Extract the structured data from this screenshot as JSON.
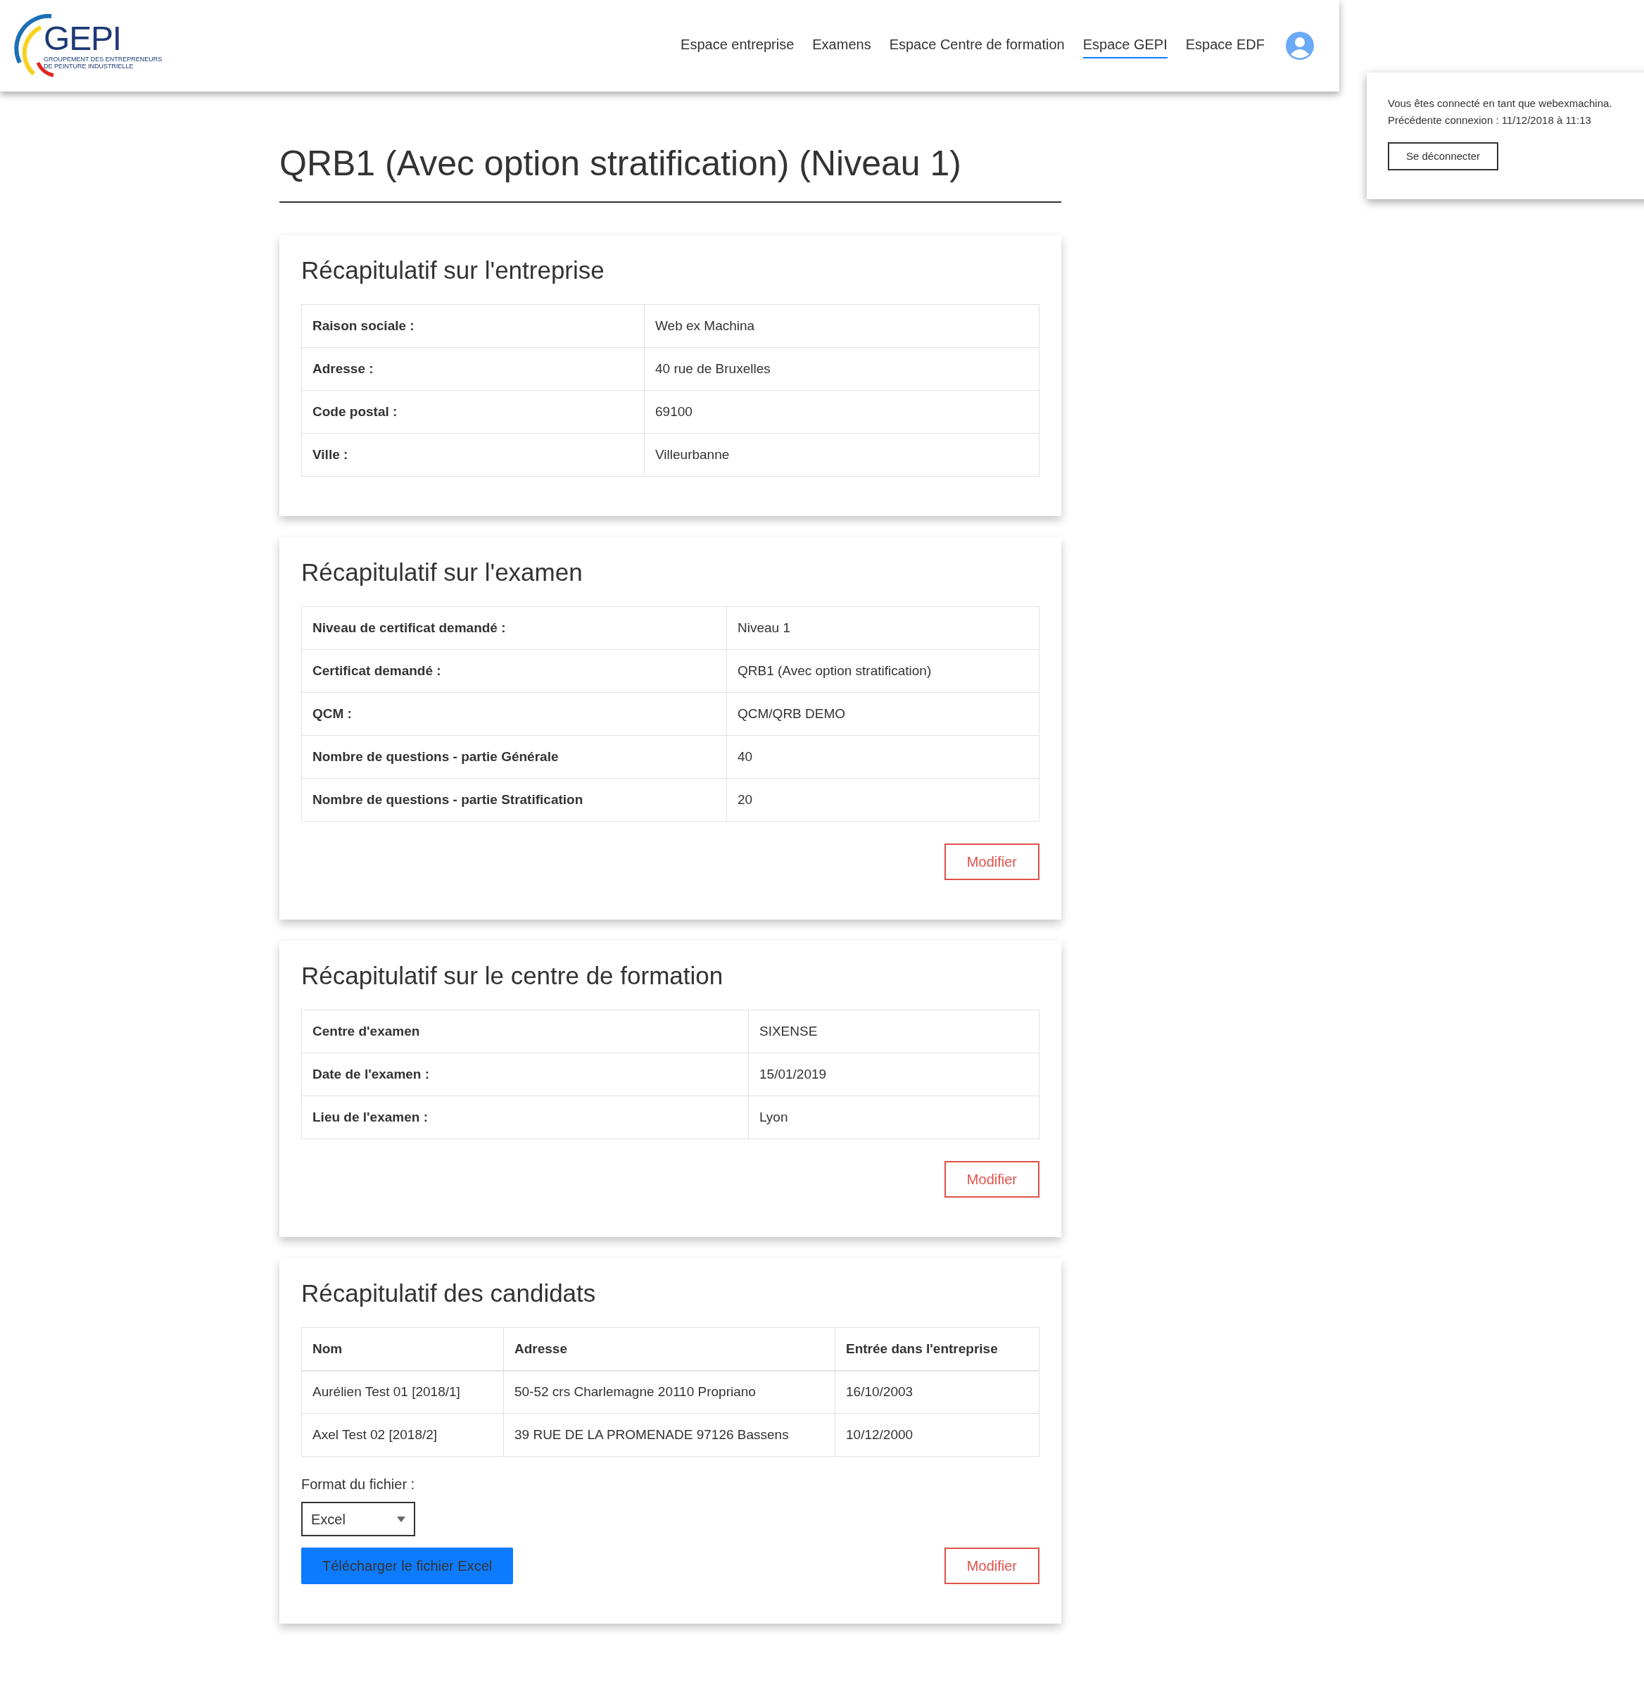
{
  "header": {
    "logo": {
      "name": "GEPI",
      "tagline_1": "GROUPEMENT DES ENTREPRENEURS",
      "tagline_2": "DE PEINTURE INDUSTRIELLE"
    },
    "nav": [
      {
        "label": "Espace entreprise",
        "selected": false
      },
      {
        "label": "Examens",
        "selected": false
      },
      {
        "label": "Espace Centre de formation",
        "selected": false
      },
      {
        "label": "Espace GEPI",
        "selected": true
      },
      {
        "label": "Espace EDF",
        "selected": false
      }
    ]
  },
  "session_popup": {
    "lines": [
      "Vous êtes connecté en tant que webexmachina.",
      "Précédente connexion : 11/12/2018 à 11:13"
    ],
    "button": "Se déconnecter"
  },
  "title": "QRB1 (Avec option stratification) (Niveau 1)",
  "sections": [
    {
      "kind": "key_value",
      "heading": "Récapitulatif sur l'entreprise",
      "rows": [
        {
          "label": "Raison sociale :",
          "value": "Web ex Machina"
        },
        {
          "label": "Adresse :",
          "value": "40 rue de Bruxelles"
        },
        {
          "label": "Code postal :",
          "value": "69100"
        },
        {
          "label": "Ville :",
          "value": "Villeurbanne"
        }
      ]
    },
    {
      "kind": "key_value",
      "heading": "Récapitulatif sur l'examen",
      "rows": [
        {
          "label": "Niveau de certificat demandé :",
          "value": "Niveau 1"
        },
        {
          "label": "Certificat demandé :",
          "value": "QRB1 (Avec option stratification)"
        },
        {
          "label": "QCM :",
          "value": "QCM/QRB DEMO"
        },
        {
          "label": "Nombre de questions - partie Générale",
          "value": "40"
        },
        {
          "label": "Nombre de questions - partie Stratification",
          "value": "20"
        }
      ],
      "button": "Modifier"
    },
    {
      "kind": "key_value",
      "heading": "Récapitulatif sur le centre de formation",
      "rows": [
        {
          "label": "Centre d'examen",
          "value": "SIXENSE"
        },
        {
          "label": "Date de l'examen :",
          "value": "15/01/2019"
        },
        {
          "label": "Lieu de l'examen :",
          "value": "Lyon"
        }
      ],
      "button": "Modifier"
    },
    {
      "kind": "candidates",
      "heading": "Récapitulatif des candidats",
      "columns": [
        "Nom",
        "Adresse",
        "Entrée dans l'entreprise"
      ],
      "rows": [
        [
          "Aurélien Test 01 [2018/1]",
          "50-52 crs Charlemagne 20110 Propriano",
          "16/10/2003"
        ],
        [
          "Axel Test 02 [2018/2]",
          "39 RUE DE LA PROMENADE 97126 Bassens",
          "10/12/2000"
        ]
      ],
      "format_label": "Format du fichier :",
      "format_value": "Excel",
      "download_button": "Télécharger le fichier Excel",
      "button": "Modifier"
    }
  ]
}
